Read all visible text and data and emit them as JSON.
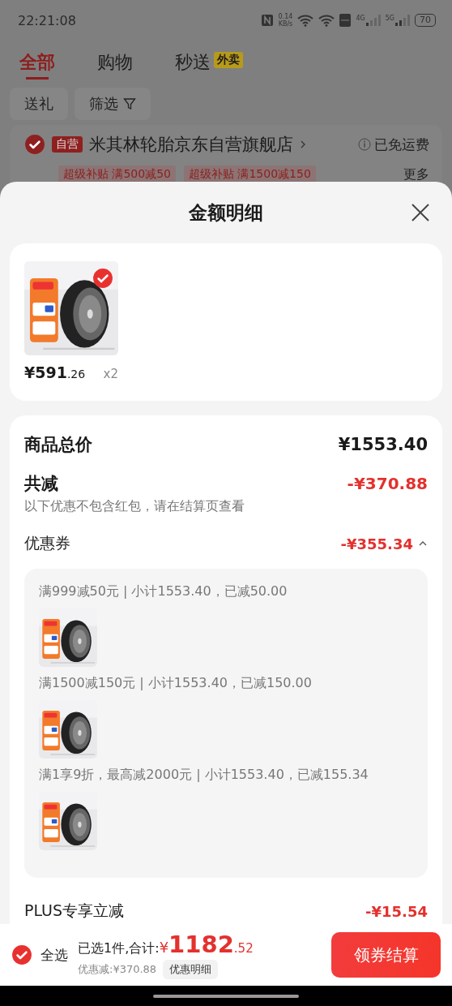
{
  "status_bar": {
    "time": "22:21:08",
    "speed_value": "0.14",
    "speed_unit": "KB/s",
    "network_1": "4G",
    "network_2": "5G",
    "battery": "70"
  },
  "tabs": [
    {
      "label": "全部",
      "selected": true
    },
    {
      "label": "购物",
      "selected": false
    },
    {
      "label": "秒送",
      "selected": false,
      "badge": "外卖"
    }
  ],
  "filters": [
    {
      "label": "送礼",
      "kind": "plain"
    },
    {
      "label": "筛选",
      "kind": "filter"
    }
  ],
  "store": {
    "checked": true,
    "tag": "自营",
    "name": "米其林轮胎京东自营旗舰店",
    "shipping": "已免运费",
    "promos": [
      "超级补贴 满500减50",
      "超级补贴 满1500减150"
    ],
    "more": "更多"
  },
  "sheet": {
    "title": "金额明细",
    "product": {
      "selected": true,
      "price_main": "¥591",
      "price_decimal": ".26",
      "quantity": "x2"
    },
    "total": {
      "label": "商品总价",
      "value": "¥1553.40"
    },
    "discount": {
      "label": "共减",
      "value": "-¥370.88",
      "note": "以下优惠不包含红包，请在结算页查看"
    },
    "coupons": {
      "label": "优惠券",
      "value": "-¥355.34",
      "expanded": true,
      "items": [
        {
          "text": "满999减50元 | 小计1553.40，已减50.00"
        },
        {
          "text": "满1500减150元 | 小计1553.40，已减150.00"
        },
        {
          "text": "满1享9折，最高减2000元 | 小计1553.40，已减155.34"
        }
      ]
    },
    "plus": {
      "label": "PLUS专享立减",
      "value": "-¥15.54"
    }
  },
  "bottom_bar": {
    "select_all": {
      "label": "全选",
      "checked": true
    },
    "selected_text": "已选1件,合计:",
    "currency": "¥",
    "total_main": "1182",
    "total_decimal": ".52",
    "discount_text": "优惠减:¥370.88",
    "details_button": "优惠明细",
    "checkout_button": "领券结算"
  }
}
